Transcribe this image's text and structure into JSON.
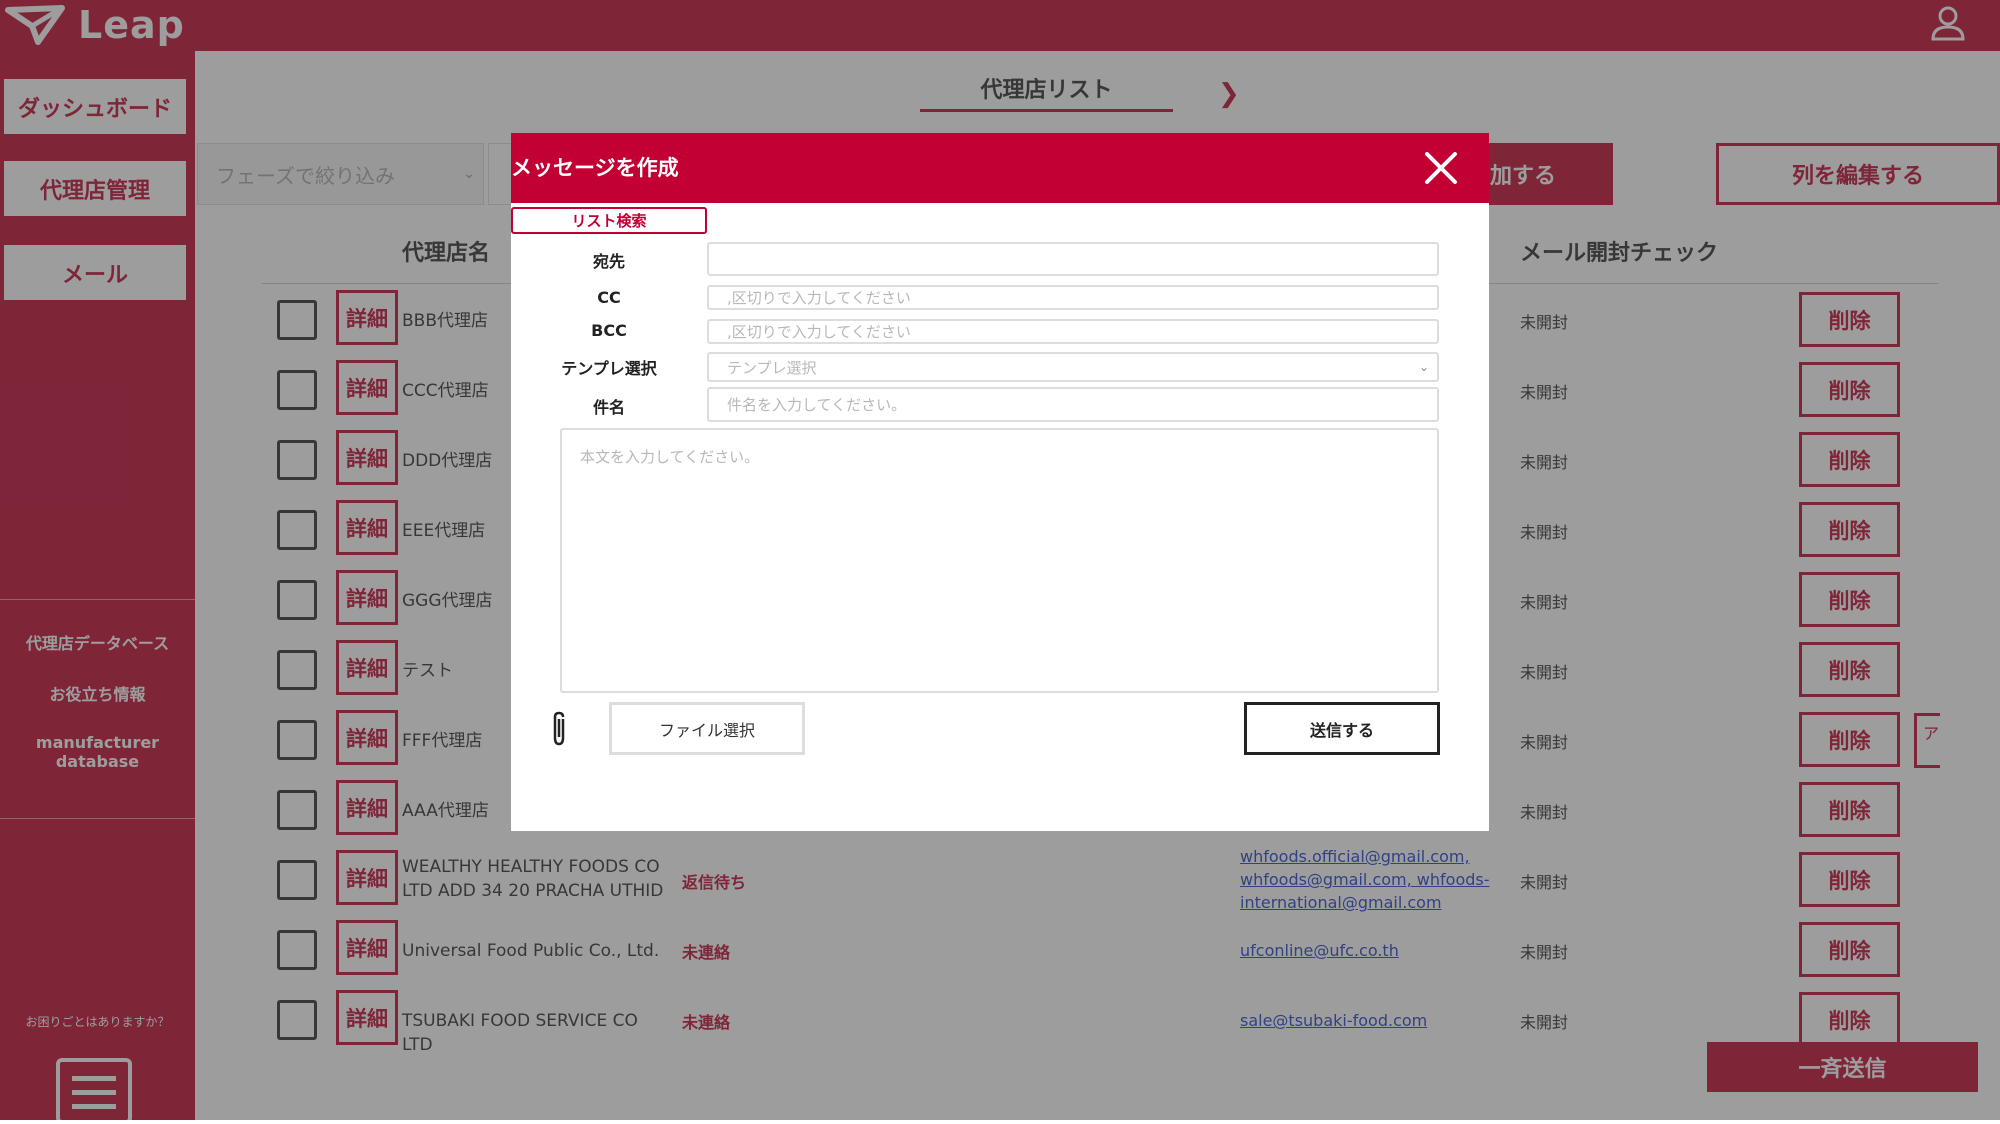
{
  "app": {
    "logo": "Leap"
  },
  "sidebar": {
    "buttons": [
      "ダッシュボード",
      "代理店管理",
      "メール"
    ],
    "links": [
      "代理店データベース",
      "お役立ち情報",
      "manufacturer database"
    ],
    "help": "お困りごとはありますか？"
  },
  "page": {
    "title": "代理店リスト"
  },
  "toolbar": {
    "filter_placeholder": "フェーズで絞り込み",
    "add_label": "加する",
    "edit_columns_label": "列を編集する"
  },
  "table": {
    "headers": {
      "name": "代理店名",
      "open_check": "メール開封チェック"
    },
    "detail_label": "詳細",
    "delete_label": "削除",
    "rows": [
      {
        "name": "BBB代理店",
        "status": "",
        "email": "",
        "open": "未開封"
      },
      {
        "name": "CCC代理店",
        "status": "",
        "email": "",
        "open": "未開封"
      },
      {
        "name": "DDD代理店",
        "status": "",
        "email": "",
        "open": "未開封"
      },
      {
        "name": "EEE代理店",
        "status": "",
        "email": "",
        "open": "未開封"
      },
      {
        "name": "GGG代理店",
        "status": "",
        "email": "",
        "open": "未開封"
      },
      {
        "name": "テスト",
        "status": "",
        "email": "",
        "open": "未開封"
      },
      {
        "name": "FFF代理店",
        "status": "",
        "email": "",
        "open": "未開封"
      },
      {
        "name": "AAA代理店",
        "status": "",
        "email": "",
        "open": "未開封"
      },
      {
        "name": "WEALTHY HEALTHY FOODS CO LTD ADD 34 20 PRACHA UTHID",
        "status": "返信待ち",
        "email": "whfoods.official@gmail.com, whfoods@gmail.com, whfoods-international@gmail.com",
        "open": "未開封"
      },
      {
        "name": "Universal Food Public Co., Ltd.",
        "status": "未連絡",
        "email": "ufconline@ufc.co.th",
        "open": "未開封"
      },
      {
        "name": "TSUBAKI FOOD SERVICE CO LTD",
        "status": "未連絡",
        "email": "sale@tsubaki-food.com",
        "open": "未開封"
      }
    ],
    "extra_label": "ア"
  },
  "bulk_send_label": "一斉送信",
  "modal": {
    "title": "メッセージを作成",
    "list_search": "リスト検索",
    "fields": {
      "to": {
        "label": "宛先",
        "value": ""
      },
      "cc": {
        "label": "CC",
        "placeholder": ",区切りで入力してください"
      },
      "bcc": {
        "label": "BCC",
        "placeholder": ",区切りで入力してください"
      },
      "template": {
        "label": "テンプレ選択",
        "placeholder": "テンプレ選択"
      },
      "subject": {
        "label": "件名",
        "placeholder": "件名を入力してください。"
      }
    },
    "body_placeholder": "本文を入力してください。",
    "file_button": "ファイル選択",
    "send_button": "送信する"
  },
  "colors": {
    "brand": "#c20e35",
    "link": "#2747c9"
  }
}
